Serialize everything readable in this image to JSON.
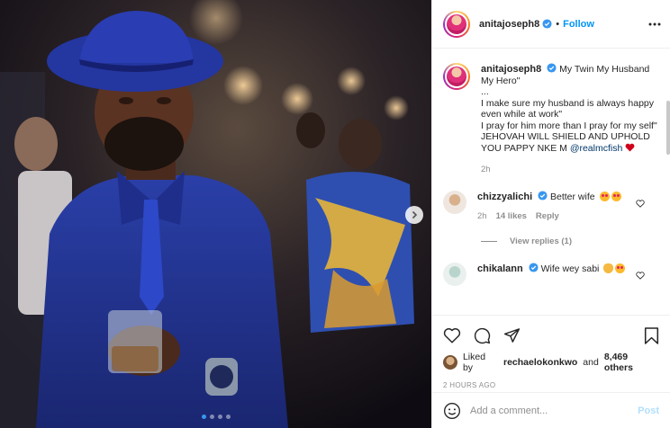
{
  "post": {
    "author": "anitajoseph8",
    "follow_label": "Follow",
    "more_icon": "more-horizontal-icon",
    "verified_color": "#3897f0"
  },
  "caption": {
    "username": "anitajoseph8",
    "lines": [
      "My Twin My Husband My Hero\"",
      "...",
      "I make sure my husband is always happy even while at work\"",
      "I pray for him more than I pray for my self\"",
      "JEHOVAH WILL SHIELD AND UPHOLD YOU PAPPY NKE M"
    ],
    "mention": "@realmcfish",
    "time": "2h"
  },
  "comments": [
    {
      "username": "chizzyalichi",
      "text": "Better wife",
      "time": "2h",
      "likes": "14 likes",
      "reply_label": "Reply",
      "view_replies": "View replies (1)"
    },
    {
      "username": "chikalann",
      "text": "Wife wey sabi"
    }
  ],
  "actions": {
    "like_icon": "heart-icon",
    "comment_icon": "comment-icon",
    "share_icon": "share-icon",
    "save_icon": "bookmark-icon"
  },
  "likes": {
    "prefix": "Liked by",
    "first_user": "rechaelokonkwo",
    "connector": "and",
    "others": "8,469 others"
  },
  "timestamp": "2 HOURS AGO",
  "composer": {
    "placeholder": "Add a comment...",
    "post_label": "Post"
  },
  "carousel": {
    "slides": 4,
    "active": 1
  }
}
